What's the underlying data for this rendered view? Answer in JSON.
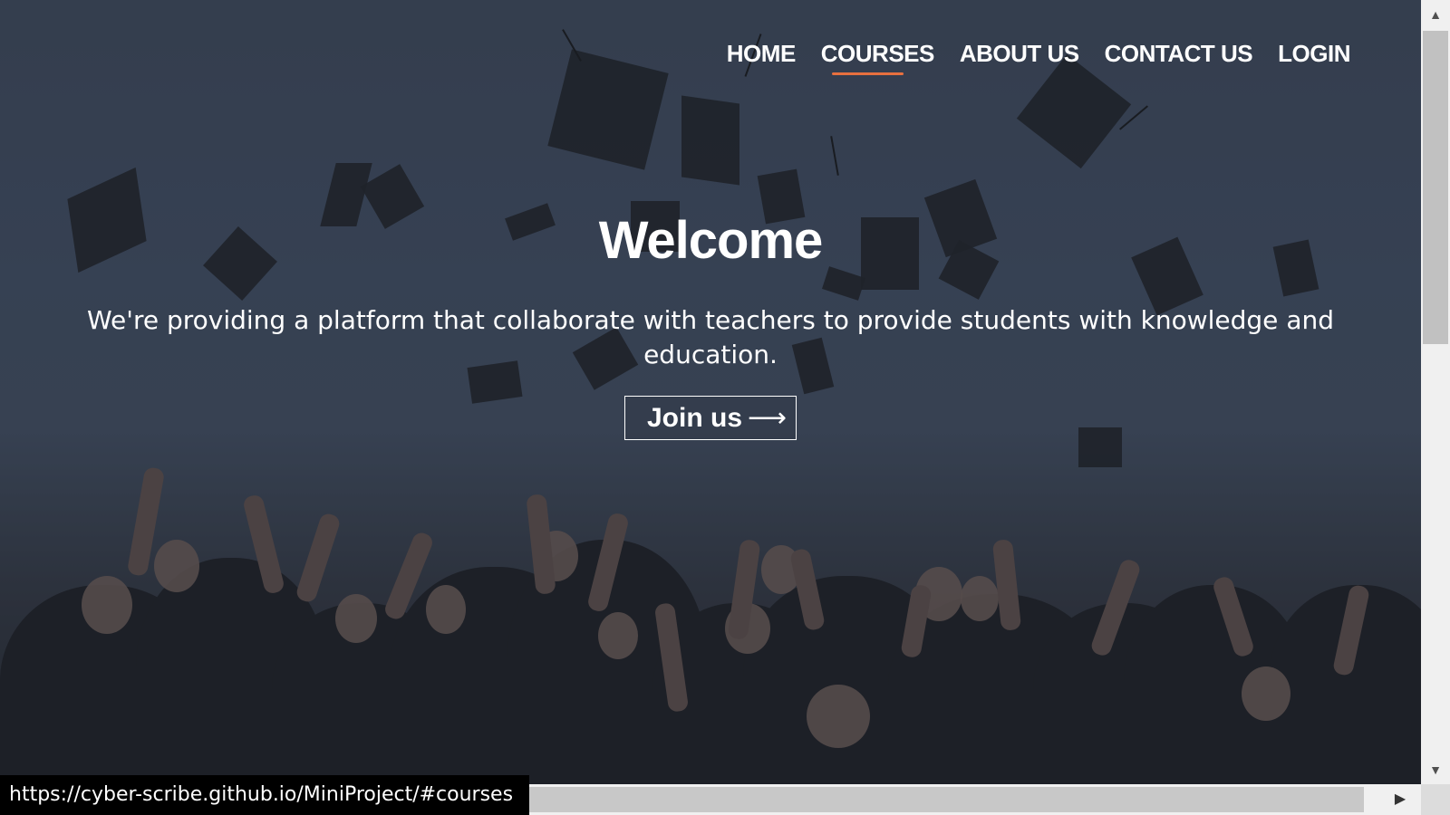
{
  "nav": {
    "items": [
      {
        "label": "HOME"
      },
      {
        "label": "COURSES"
      },
      {
        "label": "ABOUT US"
      },
      {
        "label": "CONTACT US"
      },
      {
        "label": "LOGIN"
      }
    ],
    "active": "COURSES",
    "accent_color": "#e8703f"
  },
  "hero": {
    "title": "Welcome",
    "description": "We're providing a platform that collaborate with teachers to provide students with knowledge and education.",
    "button_label": "Join us",
    "button_arrow": "⟶",
    "background_image": "graduation-caps-thrown-in-sky"
  },
  "status_bar": {
    "url": "https://cyber-scribe.github.io/MiniProject/#courses"
  },
  "scrollbars": {
    "up_arrow": "▲",
    "down_arrow": "▼",
    "right_arrow": "▶"
  }
}
